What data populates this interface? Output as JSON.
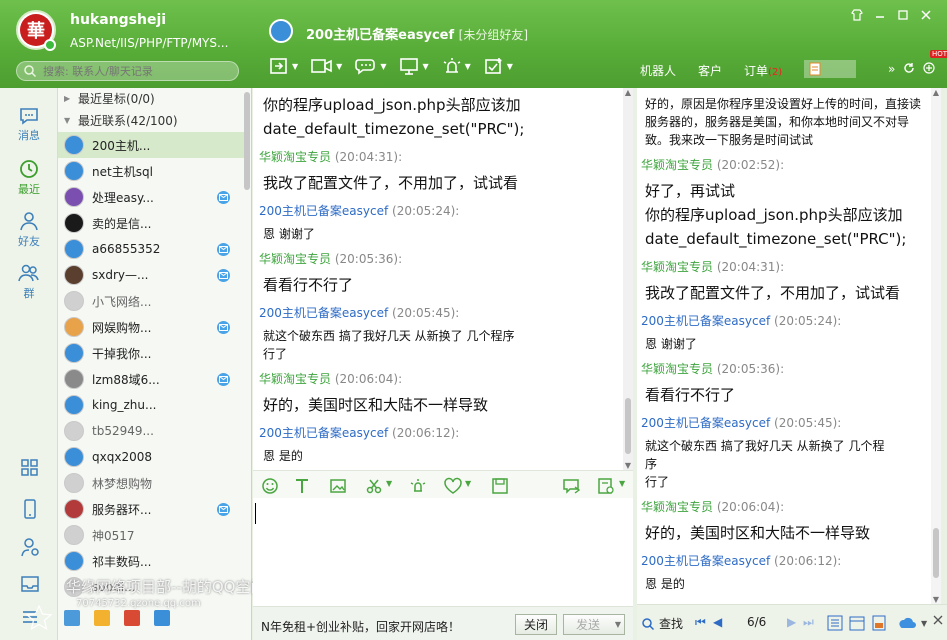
{
  "user": {
    "name": "hukangsheji",
    "signature": "ASP.Net/IIS/PHP/FTP/MYS...",
    "avatar_text": "華"
  },
  "search": {
    "placeholder": "搜索: 联系人/聊天记录"
  },
  "chat": {
    "title": "200主机已备案easycef",
    "group": "[未分组好友]"
  },
  "window": {
    "controls": [
      "skin-icon",
      "minimize-icon",
      "maximize-icon",
      "close-icon"
    ]
  },
  "toolbar": {
    "icons": [
      "file-transfer-icon",
      "video-call-icon",
      "remote-assist-icon",
      "screen-share-icon",
      "alarm-icon",
      "app-icon"
    ]
  },
  "right_tabs": {
    "robot": "机器人",
    "customer": "客户",
    "orders": "订单",
    "orders_count": "(2)",
    "hot": "HOT"
  },
  "left_nav": {
    "messages": "消息",
    "recent": "最近",
    "friends": "好友",
    "groups": "群"
  },
  "contacts": {
    "starred": "最近星标(0/0)",
    "recent": "最近联系(42/100)",
    "items": [
      {
        "name": "200主机...",
        "color": "#3b8ed8",
        "mail": false,
        "selected": true
      },
      {
        "name": "net主机sql",
        "color": "#3b8ed8",
        "mail": false
      },
      {
        "name": "处理easy...",
        "color": "#7a4fb0",
        "mail": true
      },
      {
        "name": "卖的是信...",
        "color": "#1a1a1a",
        "mail": false
      },
      {
        "name": "a66855352",
        "color": "#3b8ed8",
        "mail": true
      },
      {
        "name": "sxdry—...",
        "color": "#5a3f2f",
        "mail": true
      },
      {
        "name": "小飞网络...",
        "color": "#d0d0d0",
        "mail": false,
        "gray": true
      },
      {
        "name": "网娱购物...",
        "color": "#e8a24a",
        "mail": true
      },
      {
        "name": "干掉我你...",
        "color": "#3b8ed8",
        "mail": false
      },
      {
        "name": "lzm88域6...",
        "color": "#8a8a8a",
        "mail": true
      },
      {
        "name": "king_zhu...",
        "color": "#3b8ed8",
        "mail": false
      },
      {
        "name": "tb52949...",
        "color": "#d0d0d0",
        "mail": false,
        "gray": true
      },
      {
        "name": "qxqx2008",
        "color": "#3b8ed8",
        "mail": false
      },
      {
        "name": "林梦想购物",
        "color": "#d0d0d0",
        "mail": false,
        "gray": true
      },
      {
        "name": "服务器环...",
        "color": "#b23a3a",
        "mail": true
      },
      {
        "name": "神0517",
        "color": "#d0d0d0",
        "mail": false,
        "gray": true
      },
      {
        "name": "祁丰数码...",
        "color": "#3b8ed8",
        "mail": false
      },
      {
        "name": "suodi...",
        "color": "#d0d0d0",
        "mail": false,
        "gray": true
      }
    ]
  },
  "messages": [
    {
      "type": "text",
      "text": "你的程序upload_json.php头部应该加\ndate_default_timezone_set(\"PRC\");",
      "size": "big"
    },
    {
      "type": "sender",
      "name": "华颖淘宝专员",
      "time": "(20:04:31):",
      "color": "green"
    },
    {
      "type": "text",
      "text": "我改了配置文件了，不用加了，试试看",
      "size": "big"
    },
    {
      "type": "sender",
      "name": "200主机已备案easycef",
      "time": "(20:05:24):",
      "color": "blue"
    },
    {
      "type": "text",
      "text": "恩 谢谢了",
      "size": "small"
    },
    {
      "type": "sender",
      "name": "华颖淘宝专员",
      "time": "(20:05:36):",
      "color": "green"
    },
    {
      "type": "text",
      "text": "看看行不行了",
      "size": "big"
    },
    {
      "type": "sender",
      "name": "200主机已备案easycef",
      "time": "(20:05:45):",
      "color": "blue"
    },
    {
      "type": "text",
      "text": "就这个破东西 搞了我好几天  从新换了 几个程序\n行了",
      "size": "small"
    },
    {
      "type": "sender",
      "name": "华颖淘宝专员",
      "time": "(20:06:04):",
      "color": "green"
    },
    {
      "type": "text",
      "text": "好的，美国时区和大陆不一样导致",
      "size": "big"
    },
    {
      "type": "sender",
      "name": "200主机已备案easycef",
      "time": "(20:06:12):",
      "color": "blue"
    },
    {
      "type": "text",
      "text": "恩  是的",
      "size": "small"
    }
  ],
  "history": [
    {
      "type": "text",
      "text": "好的，原因是你程序里没设置好上传的时间，直接读\n服务器的，服务器是美国，和你本地时间又不对导\n致。我来改一下服务是时间试试",
      "size": "small"
    },
    {
      "type": "sender",
      "name": "华颖淘宝专员",
      "time": "(20:02:52):",
      "color": "green"
    },
    {
      "type": "text",
      "text": "好了，再试试\n你的程序upload_json.php头部应该加\ndate_default_timezone_set(\"PRC\");",
      "size": "big"
    },
    {
      "type": "sender",
      "name": "华颖淘宝专员",
      "time": "(20:04:31):",
      "color": "green"
    },
    {
      "type": "text",
      "text": "我改了配置文件了，不用加了，试试看",
      "size": "big"
    },
    {
      "type": "sender",
      "name": "200主机已备案easycef",
      "time": "(20:05:24):",
      "color": "blue"
    },
    {
      "type": "text",
      "text": "恩 谢谢了",
      "size": "small"
    },
    {
      "type": "sender",
      "name": "华颖淘宝专员",
      "time": "(20:05:36):",
      "color": "green"
    },
    {
      "type": "text",
      "text": "看看行不行了",
      "size": "big"
    },
    {
      "type": "sender",
      "name": "200主机已备案easycef",
      "time": "(20:05:45):",
      "color": "blue"
    },
    {
      "type": "text",
      "text": "就这个破东西 搞了我好几天  从新换了 几个程\n序\n行了",
      "size": "small"
    },
    {
      "type": "sender",
      "name": "华颖淘宝专员",
      "time": "(20:06:04):",
      "color": "green"
    },
    {
      "type": "text",
      "text": "好的，美国时区和大陆不一样导致",
      "size": "big"
    },
    {
      "type": "sender",
      "name": "200主机已备案easycef",
      "time": "(20:06:12):",
      "color": "blue"
    },
    {
      "type": "text",
      "text": "恩  是的",
      "size": "small"
    }
  ],
  "input_toolbar": {
    "icons": [
      "emoji-icon",
      "font-icon",
      "image-icon",
      "screenshot-icon",
      "shake-icon",
      "favorite-icon",
      "save-icon",
      "voice-icon",
      "history-icon"
    ]
  },
  "bottom": {
    "ad": "N年免租+创业补贴，回家开网店咯！",
    "close": "关闭",
    "send": "发送"
  },
  "history_bar": {
    "search": "查找",
    "page": "6/6"
  },
  "watermark": {
    "line1": "华缘网络项目部--胡的QQ空间",
    "line2": "70745732.qzone.qq.com"
  },
  "colors": {
    "header": "#58ad38",
    "sender_green": "#3fa53f",
    "sender_blue": "#2d6bc5",
    "accent": "#3d7fb9"
  }
}
